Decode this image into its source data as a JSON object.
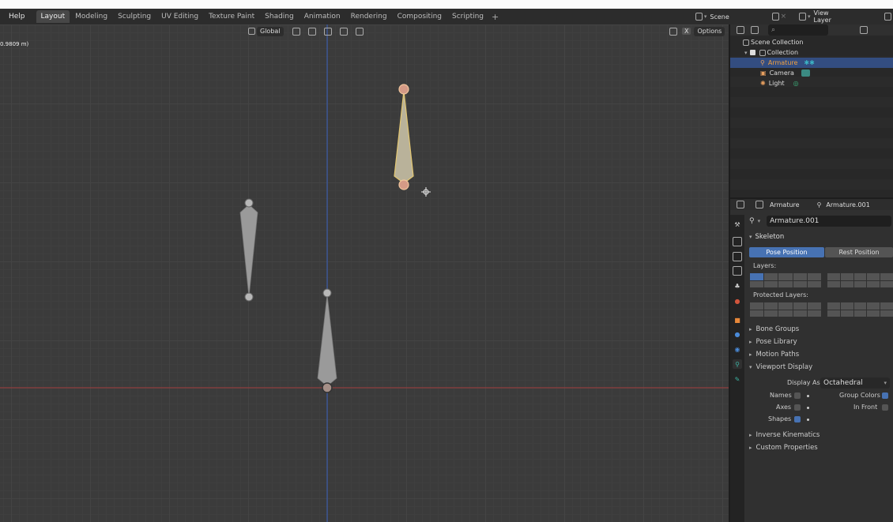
{
  "menu": {
    "help": "Help"
  },
  "workspaces": [
    "Layout",
    "Modeling",
    "Sculpting",
    "UV Editing",
    "Texture Paint",
    "Shading",
    "Animation",
    "Rendering",
    "Compositing",
    "Scripting"
  ],
  "add_workspace": "+",
  "scene": {
    "label": "Scene",
    "view_layer": "View Layer",
    "close": "×"
  },
  "viewport": {
    "info_text": "0.9809 m)",
    "orientation": "Global",
    "options": "Options",
    "x_label": "X",
    "colors": {
      "bone": "#9a9a9a",
      "selected_bone": "#d8c98a",
      "x_axis": "#a33d3d",
      "y_axis": "#3a5aa8"
    }
  },
  "outliner": {
    "search_placeholder": "",
    "rows": [
      {
        "label": "Scene Collection"
      },
      {
        "label": "Collection"
      },
      {
        "label": "Armature"
      },
      {
        "label": "Camera"
      },
      {
        "label": "Light"
      }
    ]
  },
  "properties": {
    "object_name": "Armature",
    "data_name": "Armature.001",
    "datablock_field": "Armature.001",
    "skeleton": {
      "title": "Skeleton",
      "pose_position": "Pose Position",
      "rest_position": "Rest Position",
      "layers_label": "Layers:",
      "protected_label": "Protected Layers:"
    },
    "collapsed_panels": [
      "Bone Groups",
      "Pose Library",
      "Motion Paths"
    ],
    "viewport_display": {
      "title": "Viewport Display",
      "display_as_label": "Display As",
      "display_as_value": "Octahedral",
      "names": "Names",
      "axes": "Axes",
      "shapes": "Shapes",
      "group_colors": "Group Colors",
      "in_front": "In Front"
    },
    "bottom_panels": [
      "Inverse Kinematics",
      "Custom Properties"
    ]
  }
}
